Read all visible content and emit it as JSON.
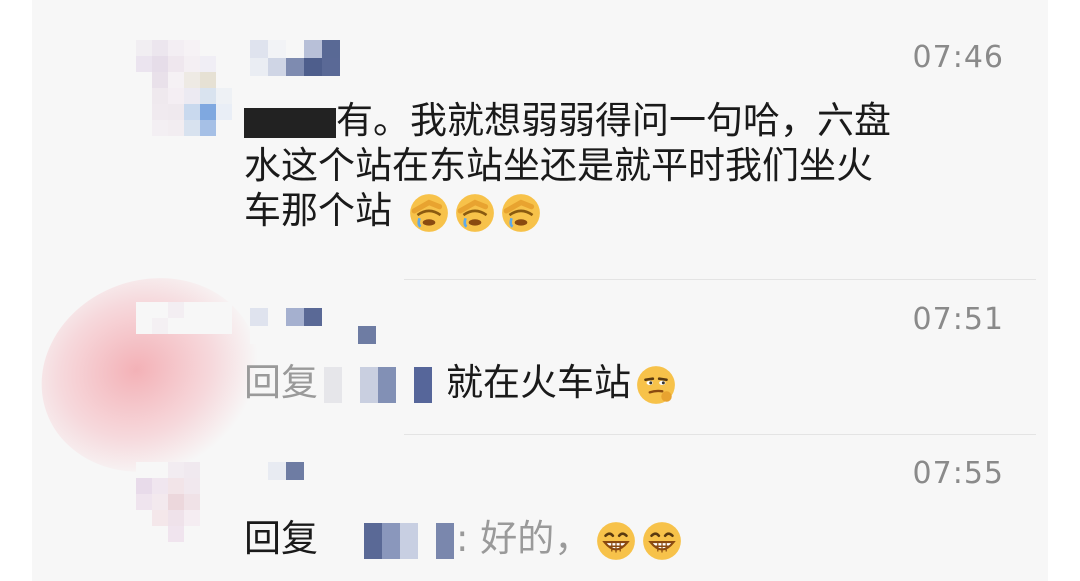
{
  "messages": [
    {
      "time": "07:46",
      "text_visible_suffix": "有。我就想弱弱得问一句哈，六盘",
      "line2": "水这个站在东站坐还是就平时我们坐火",
      "line3": "车那个站",
      "emojis": [
        "facepalm-icon",
        "facepalm-icon",
        "facepalm-icon"
      ]
    },
    {
      "time": "07:51",
      "reply_prefix": "回复",
      "text": "就在火车站",
      "emojis": [
        "smirk-icon"
      ]
    },
    {
      "time": "07:55",
      "reply_prefix": "回复",
      "text": ": 好的，",
      "emojis": [
        "grin-icon",
        "grin-icon"
      ]
    }
  ]
}
